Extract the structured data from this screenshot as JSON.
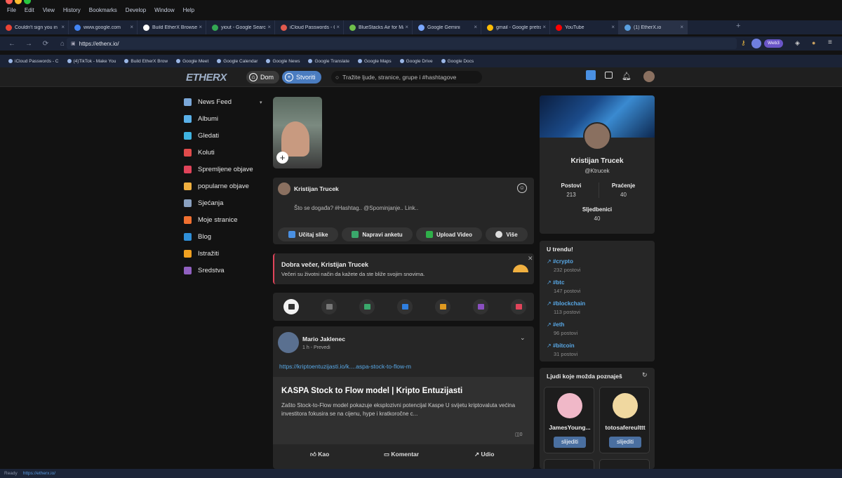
{
  "menubar": {
    "items": [
      "File",
      "Edit",
      "View",
      "History",
      "Bookmarks",
      "Develop",
      "Window",
      "Help"
    ]
  },
  "tabs": [
    {
      "title": "Couldn't sign you in",
      "icon": "google-icon",
      "color": "#ea4335"
    },
    {
      "title": "www.google.com",
      "icon": "google-icon",
      "color": "#4285f4"
    },
    {
      "title": "Build EtherX Browser - W...",
      "icon": "github-icon",
      "color": "#ffffff"
    },
    {
      "title": "yiout - Google Search",
      "icon": "google-icon",
      "color": "#34a853"
    },
    {
      "title": "iCloud Passwords - Chrome ...",
      "icon": "icloud-icon",
      "color": "#e05a4e"
    },
    {
      "title": "BlueStacks Air for Mac",
      "icon": "bluestacks-icon",
      "color": "#6fbf4a"
    },
    {
      "title": "Google Gemini",
      "icon": "gemini-icon",
      "color": "#7aa7ff"
    },
    {
      "title": "gmail - Google pretraživanje",
      "icon": "google-icon",
      "color": "#fbbc05"
    },
    {
      "title": "YouTube",
      "icon": "youtube-icon",
      "color": "#ff0000"
    },
    {
      "title": "(1) EtherX.io",
      "icon": "etherx-icon",
      "color": "#5aa0e0"
    }
  ],
  "address": {
    "url": "https://etherx.io/",
    "web3_badge": "Web3"
  },
  "bookmarks": [
    "iCloud Passwords - C",
    "(4)TikTok - Make You",
    "Build EtherX Brow",
    "Google Meet",
    "Google Calendar",
    "Google News",
    "Google Translate",
    "Google Maps",
    "Google Drive",
    "Google Docs"
  ],
  "site": {
    "logo": "ETHERX",
    "home_label": "Dom",
    "create_label": "Stvoriti",
    "search_placeholder": "Tražite ljude, stranice, grupe i #hashtagove",
    "sidebar": [
      {
        "label": "News Feed",
        "color": "#7aa7d8"
      },
      {
        "label": "Albumi",
        "color": "#5ab0e8"
      },
      {
        "label": "Gledati",
        "color": "#3fb3e0"
      },
      {
        "label": "Koluti",
        "color": "#e04b4b"
      },
      {
        "label": "Spremljene objave",
        "color": "#e0445a"
      },
      {
        "label": "popularne objave",
        "color": "#f0b040"
      },
      {
        "label": "Sjećanja",
        "color": "#8aa0c0"
      },
      {
        "label": "Moje stranice",
        "color": "#f07030"
      },
      {
        "label": "Blog",
        "color": "#2f8fd8"
      },
      {
        "label": "Istražiti",
        "color": "#f0a020"
      },
      {
        "label": "Sredstva",
        "color": "#9060c0"
      }
    ],
    "composer": {
      "author": "Kristijan Trucek",
      "placeholder": "Što se događa? #Hashtag.. @Spominjanje.. Link..",
      "buttons": [
        {
          "label": "Učitaj slike",
          "color": "#4a90e2"
        },
        {
          "label": "Napravi anketu",
          "color": "#3aa86b"
        },
        {
          "label": "Upload Video",
          "color": "#2fb04a"
        },
        {
          "label": "Više",
          "color": "#cccccc"
        }
      ]
    },
    "greeting": {
      "title": "Dobra večer, Kristijan Trucek",
      "text": "Večeri su životni način da kažete da ste bliže svojim snovima."
    },
    "filter_icons": [
      {
        "name": "all-posts-icon",
        "color": "#ffffff"
      },
      {
        "name": "text-icon",
        "color": "#777777"
      },
      {
        "name": "photo-icon",
        "color": "#3aa86b"
      },
      {
        "name": "video-icon",
        "color": "#2f7fe0"
      },
      {
        "name": "music-icon",
        "color": "#e09a20"
      },
      {
        "name": "file-icon",
        "color": "#8a4fc0"
      },
      {
        "name": "live-icon",
        "color": "#e0445a"
      }
    ],
    "post": {
      "author": "Mario Jaklenec",
      "meta": "1 h - Prevedi",
      "link": "https://kriptoentuzijasti.io/k....aspa-stock-to-flow-m",
      "preview_title": "KASPA Stock to Flow model | Kripto Entuzijasti",
      "preview_text": "Zašto Stock-to-Flow model pokazuje eksplozivni potencijal Kaspe U svijetu kriptovaluta većina investitora fokusira se na cijenu, hype i kratkoročne c...",
      "views": "0",
      "like": "Kao",
      "comment": "Komentar",
      "share": "Udio"
    },
    "profile": {
      "name": "Kristijan Trucek",
      "handle": "@Ktrucek",
      "posts_label": "Postovi",
      "posts": "213",
      "following_label": "Praćenje",
      "following": "40",
      "followers_label": "Sljedbenici",
      "followers": "40"
    },
    "trending": {
      "title": "U trendu!",
      "items": [
        {
          "tag": "#crypto",
          "count": "232 postovi"
        },
        {
          "tag": "#btc",
          "count": "147 postovi"
        },
        {
          "tag": "#blockchain",
          "count": "113 postovi"
        },
        {
          "tag": "#eth",
          "count": "96 postovi"
        },
        {
          "tag": "#bitcoin",
          "count": "31 postovi"
        }
      ]
    },
    "people": {
      "title": "Ljudi koje možda poznaješ",
      "follow": "slijediti",
      "items": [
        {
          "name": "JamesYoung..."
        },
        {
          "name": "totosafereulttt"
        }
      ]
    }
  },
  "status": {
    "ready": "Ready",
    "url": "https://etherx.io/"
  }
}
